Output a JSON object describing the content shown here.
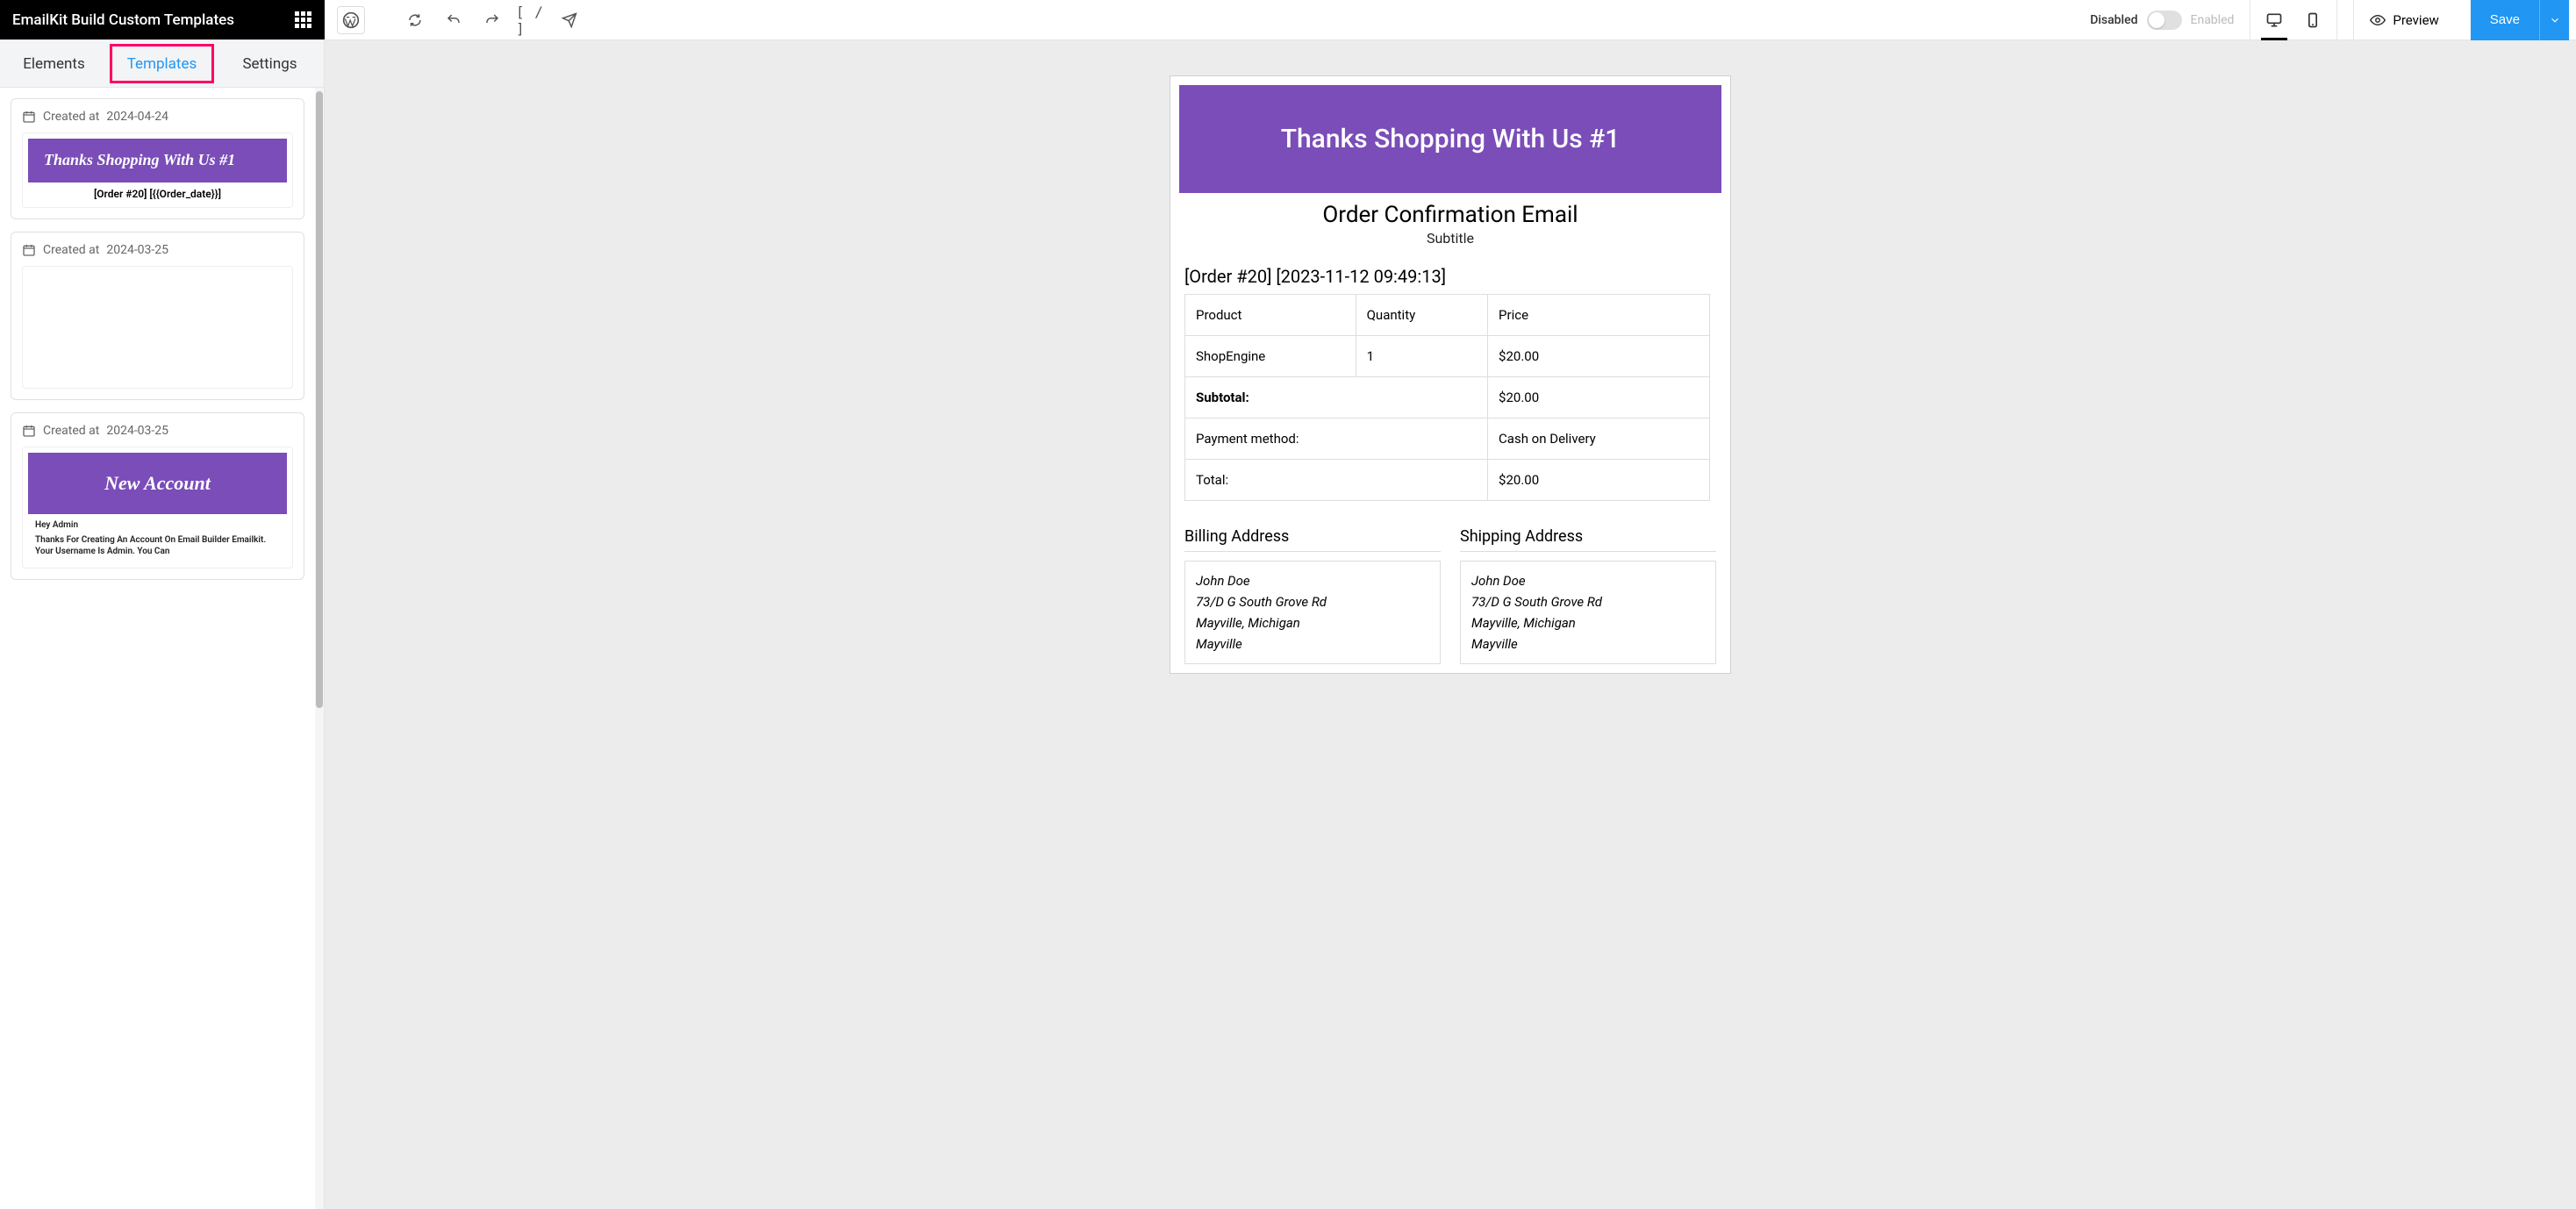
{
  "brand": {
    "title": "EmailKit Build Custom Templates"
  },
  "toolbar": {
    "disabled_label": "Disabled",
    "enabled_label": "Enabled",
    "code_slash": "[ / ]",
    "preview_label": "Preview",
    "save_label": "Save"
  },
  "sidebar": {
    "tabs": {
      "elements": "Elements",
      "templates": "Templates",
      "settings": "Settings",
      "active": "templates"
    },
    "templates": [
      {
        "created_prefix": "Created at",
        "created_date": "2024-04-24",
        "banner_text": "Thanks Shopping With Us #1",
        "sub_text": "[Order #20] [{{Order_date}}]"
      },
      {
        "created_prefix": "Created at",
        "created_date": "2024-03-25"
      },
      {
        "created_prefix": "Created at",
        "created_date": "2024-03-25",
        "banner_text": "New Account",
        "greeting": "Hey Admin",
        "body_text": "Thanks For Creating An Account On Email Builder Emailkit. Your Username Is Admin. You Can"
      }
    ]
  },
  "email": {
    "hero": "Thanks Shopping With Us #1",
    "title": "Order Confirmation Email",
    "subtitle": "Subtitle",
    "order_header": "[Order #20] [2023-11-12 09:49:13]",
    "table": {
      "headers": {
        "product": "Product",
        "quantity": "Quantity",
        "price": "Price"
      },
      "row": {
        "product": "ShopEngine",
        "quantity": "1",
        "price": "$20.00"
      },
      "subtotal_label": "Subtotal:",
      "subtotal_value": "$20.00",
      "payment_label": "Payment method:",
      "payment_value": "Cash on Delivery",
      "total_label": "Total:",
      "total_value": "$20.00"
    },
    "billing": {
      "title": "Billing Address",
      "name": "John Doe",
      "street": "73/D G South Grove Rd",
      "city": "Mayville, Michigan",
      "extra": "Mayville"
    },
    "shipping": {
      "title": "Shipping Address",
      "name": "John Doe",
      "street": "73/D G South Grove Rd",
      "city": "Mayville, Michigan",
      "extra": "Mayville"
    }
  }
}
